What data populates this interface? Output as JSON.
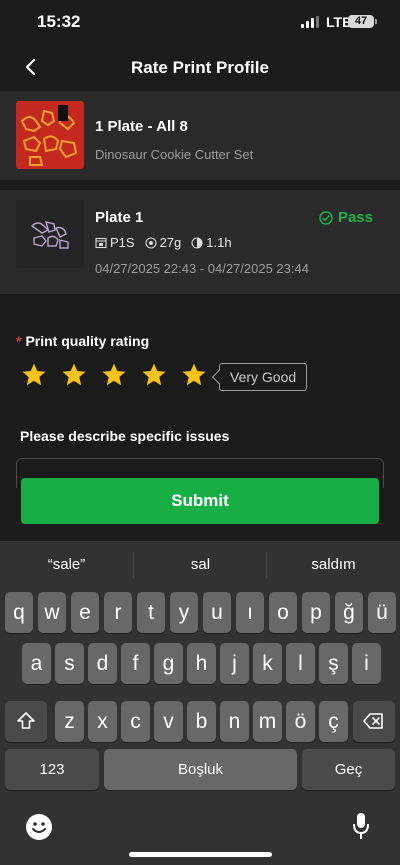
{
  "status_bar": {
    "time": "15:32",
    "network": "LTE",
    "battery": "47"
  },
  "header": {
    "title": "Rate Print Profile",
    "back_icon": "chevron-left-icon"
  },
  "profile": {
    "title": "1 Plate - All 8",
    "subtitle": "Dinosaur Cookie Cutter Set"
  },
  "plate": {
    "title": "Plate 1",
    "status": "Pass",
    "status_color": "#1fb24a",
    "printer": "P1S",
    "weight": "27g",
    "duration": "1.1h",
    "date_range": "04/27/2025 22:43 - 04/27/2025 23:44"
  },
  "rating": {
    "label": "Print quality rating",
    "required_mark": "*",
    "value": 5,
    "max": 5,
    "star_color": "#f7c21b",
    "tag": "Very Good"
  },
  "issues": {
    "label": "Please describe specific issues",
    "value": ""
  },
  "submit": {
    "label": "Submit",
    "color": "#19ae45"
  },
  "keyboard": {
    "suggestions": [
      "“sale”",
      "sal",
      "saldım"
    ],
    "row1": [
      "q",
      "w",
      "e",
      "r",
      "t",
      "y",
      "u",
      "ı",
      "o",
      "p",
      "ğ",
      "ü"
    ],
    "row2": [
      "a",
      "s",
      "d",
      "f",
      "g",
      "h",
      "j",
      "k",
      "l",
      "ş",
      "i"
    ],
    "row3": [
      "z",
      "x",
      "c",
      "v",
      "b",
      "n",
      "m",
      "ö",
      "ç"
    ],
    "numbers_label": "123",
    "space_label": "Boşluk",
    "return_label": "Geç"
  }
}
